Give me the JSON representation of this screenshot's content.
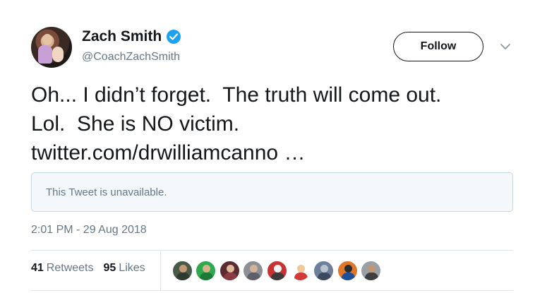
{
  "user": {
    "name": "Zach Smith",
    "handle": "@CoachZachSmith",
    "verified": true,
    "avatar_icon": "profile-photo-avatar"
  },
  "actions": {
    "follow_label": "Follow",
    "caret_icon": "chevron-down-icon"
  },
  "tweet": {
    "lines": [
      "Oh... I didn’t forget.  The truth will come out.",
      "Lol.  She is NO victim."
    ],
    "link": "twitter.com/drwilliamcanno …",
    "quoted_unavailable": "This Tweet is unavailable.",
    "timestamp": "2:01 PM - 29 Aug 2018"
  },
  "stats": {
    "retweets_count": "41",
    "retweets_label": "Retweets",
    "likes_count": "95",
    "likes_label": "Likes"
  },
  "likers": [
    {
      "name": "liker-avatar-1",
      "bg": "#4a5a48",
      "head": "#c49a76",
      "body": "#2d3a30"
    },
    {
      "name": "liker-avatar-2",
      "bg": "#2fa84f",
      "head": "#d8b08a",
      "body": "#1d7a36"
    },
    {
      "name": "liker-avatar-3",
      "bg": "#5a2b30",
      "head": "#e0b89a",
      "body": "#8a3a45"
    },
    {
      "name": "liker-avatar-4",
      "bg": "#8c8f96",
      "head": "#d4b497",
      "body": "#5d6068"
    },
    {
      "name": "liker-avatar-5",
      "bg": "#c83232",
      "head": "#f2f2f2",
      "body": "#3a3a3a"
    },
    {
      "name": "liker-avatar-6",
      "bg": "#ffffff",
      "head": "#f2c79a",
      "body": "#d23a3a"
    },
    {
      "name": "liker-avatar-7",
      "bg": "#6d7f9a",
      "head": "#b9c2cf",
      "body": "#3c4a60"
    },
    {
      "name": "liker-avatar-8",
      "bg": "#e0762a",
      "head": "#2b2b2b",
      "body": "#1c4f9c"
    },
    {
      "name": "liker-avatar-9",
      "bg": "#9aa0a6",
      "head": "#c29776",
      "body": "#3f3f3f"
    }
  ]
}
